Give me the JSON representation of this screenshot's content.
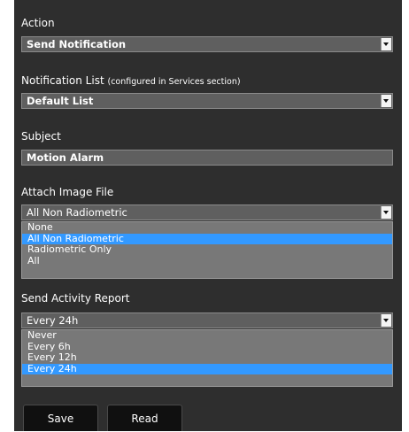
{
  "action": {
    "label": "Action",
    "value": "Send Notification"
  },
  "notification_list": {
    "label": "Notification List",
    "note": "(configured in Services section)",
    "value": "Default List"
  },
  "subject": {
    "label": "Subject",
    "value": "Motion Alarm"
  },
  "attach_image": {
    "label": "Attach Image File",
    "value": "All Non Radiometric",
    "options": [
      "None",
      "All Non Radiometric",
      "Radiometric Only",
      "All"
    ],
    "selected_index": 1
  },
  "activity_report": {
    "label": "Send Activity Report",
    "value": "Every 24h",
    "options": [
      "Never",
      "Every 6h",
      "Every 12h",
      "Every 24h"
    ],
    "selected_index": 3
  },
  "buttons": {
    "save": "Save",
    "read": "Read"
  },
  "colors": {
    "panel": "#2e2e2e",
    "field": "#5f5f5f",
    "dropdown": "#787878",
    "highlight": "#3399ff",
    "button": "#101010"
  },
  "icons": {
    "dropdown_arrow": "chevron-down-icon"
  }
}
